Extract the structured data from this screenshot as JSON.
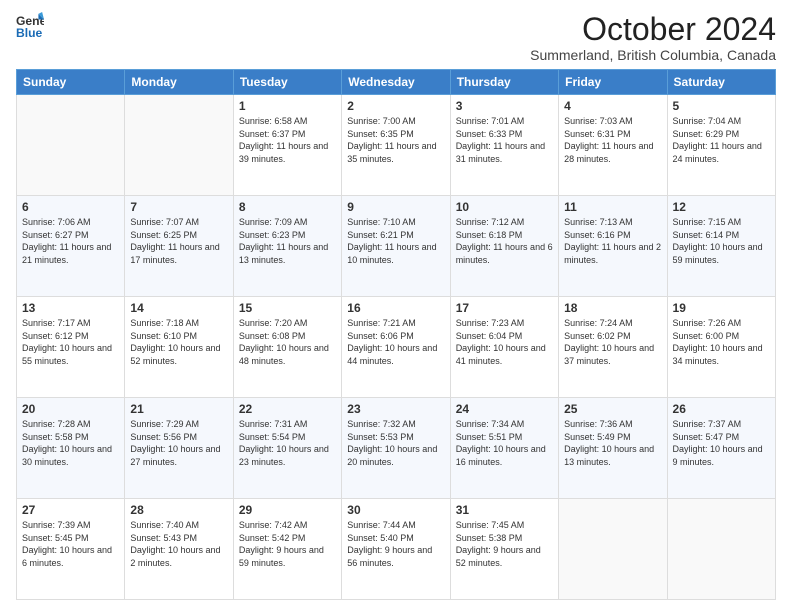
{
  "logo": {
    "line1": "General",
    "line2": "Blue"
  },
  "header": {
    "month": "October 2024",
    "location": "Summerland, British Columbia, Canada"
  },
  "weekdays": [
    "Sunday",
    "Monday",
    "Tuesday",
    "Wednesday",
    "Thursday",
    "Friday",
    "Saturday"
  ],
  "weeks": [
    [
      {
        "day": "",
        "sunrise": "",
        "sunset": "",
        "daylight": ""
      },
      {
        "day": "",
        "sunrise": "",
        "sunset": "",
        "daylight": ""
      },
      {
        "day": "1",
        "sunrise": "Sunrise: 6:58 AM",
        "sunset": "Sunset: 6:37 PM",
        "daylight": "Daylight: 11 hours and 39 minutes."
      },
      {
        "day": "2",
        "sunrise": "Sunrise: 7:00 AM",
        "sunset": "Sunset: 6:35 PM",
        "daylight": "Daylight: 11 hours and 35 minutes."
      },
      {
        "day": "3",
        "sunrise": "Sunrise: 7:01 AM",
        "sunset": "Sunset: 6:33 PM",
        "daylight": "Daylight: 11 hours and 31 minutes."
      },
      {
        "day": "4",
        "sunrise": "Sunrise: 7:03 AM",
        "sunset": "Sunset: 6:31 PM",
        "daylight": "Daylight: 11 hours and 28 minutes."
      },
      {
        "day": "5",
        "sunrise": "Sunrise: 7:04 AM",
        "sunset": "Sunset: 6:29 PM",
        "daylight": "Daylight: 11 hours and 24 minutes."
      }
    ],
    [
      {
        "day": "6",
        "sunrise": "Sunrise: 7:06 AM",
        "sunset": "Sunset: 6:27 PM",
        "daylight": "Daylight: 11 hours and 21 minutes."
      },
      {
        "day": "7",
        "sunrise": "Sunrise: 7:07 AM",
        "sunset": "Sunset: 6:25 PM",
        "daylight": "Daylight: 11 hours and 17 minutes."
      },
      {
        "day": "8",
        "sunrise": "Sunrise: 7:09 AM",
        "sunset": "Sunset: 6:23 PM",
        "daylight": "Daylight: 11 hours and 13 minutes."
      },
      {
        "day": "9",
        "sunrise": "Sunrise: 7:10 AM",
        "sunset": "Sunset: 6:21 PM",
        "daylight": "Daylight: 11 hours and 10 minutes."
      },
      {
        "day": "10",
        "sunrise": "Sunrise: 7:12 AM",
        "sunset": "Sunset: 6:18 PM",
        "daylight": "Daylight: 11 hours and 6 minutes."
      },
      {
        "day": "11",
        "sunrise": "Sunrise: 7:13 AM",
        "sunset": "Sunset: 6:16 PM",
        "daylight": "Daylight: 11 hours and 2 minutes."
      },
      {
        "day": "12",
        "sunrise": "Sunrise: 7:15 AM",
        "sunset": "Sunset: 6:14 PM",
        "daylight": "Daylight: 10 hours and 59 minutes."
      }
    ],
    [
      {
        "day": "13",
        "sunrise": "Sunrise: 7:17 AM",
        "sunset": "Sunset: 6:12 PM",
        "daylight": "Daylight: 10 hours and 55 minutes."
      },
      {
        "day": "14",
        "sunrise": "Sunrise: 7:18 AM",
        "sunset": "Sunset: 6:10 PM",
        "daylight": "Daylight: 10 hours and 52 minutes."
      },
      {
        "day": "15",
        "sunrise": "Sunrise: 7:20 AM",
        "sunset": "Sunset: 6:08 PM",
        "daylight": "Daylight: 10 hours and 48 minutes."
      },
      {
        "day": "16",
        "sunrise": "Sunrise: 7:21 AM",
        "sunset": "Sunset: 6:06 PM",
        "daylight": "Daylight: 10 hours and 44 minutes."
      },
      {
        "day": "17",
        "sunrise": "Sunrise: 7:23 AM",
        "sunset": "Sunset: 6:04 PM",
        "daylight": "Daylight: 10 hours and 41 minutes."
      },
      {
        "day": "18",
        "sunrise": "Sunrise: 7:24 AM",
        "sunset": "Sunset: 6:02 PM",
        "daylight": "Daylight: 10 hours and 37 minutes."
      },
      {
        "day": "19",
        "sunrise": "Sunrise: 7:26 AM",
        "sunset": "Sunset: 6:00 PM",
        "daylight": "Daylight: 10 hours and 34 minutes."
      }
    ],
    [
      {
        "day": "20",
        "sunrise": "Sunrise: 7:28 AM",
        "sunset": "Sunset: 5:58 PM",
        "daylight": "Daylight: 10 hours and 30 minutes."
      },
      {
        "day": "21",
        "sunrise": "Sunrise: 7:29 AM",
        "sunset": "Sunset: 5:56 PM",
        "daylight": "Daylight: 10 hours and 27 minutes."
      },
      {
        "day": "22",
        "sunrise": "Sunrise: 7:31 AM",
        "sunset": "Sunset: 5:54 PM",
        "daylight": "Daylight: 10 hours and 23 minutes."
      },
      {
        "day": "23",
        "sunrise": "Sunrise: 7:32 AM",
        "sunset": "Sunset: 5:53 PM",
        "daylight": "Daylight: 10 hours and 20 minutes."
      },
      {
        "day": "24",
        "sunrise": "Sunrise: 7:34 AM",
        "sunset": "Sunset: 5:51 PM",
        "daylight": "Daylight: 10 hours and 16 minutes."
      },
      {
        "day": "25",
        "sunrise": "Sunrise: 7:36 AM",
        "sunset": "Sunset: 5:49 PM",
        "daylight": "Daylight: 10 hours and 13 minutes."
      },
      {
        "day": "26",
        "sunrise": "Sunrise: 7:37 AM",
        "sunset": "Sunset: 5:47 PM",
        "daylight": "Daylight: 10 hours and 9 minutes."
      }
    ],
    [
      {
        "day": "27",
        "sunrise": "Sunrise: 7:39 AM",
        "sunset": "Sunset: 5:45 PM",
        "daylight": "Daylight: 10 hours and 6 minutes."
      },
      {
        "day": "28",
        "sunrise": "Sunrise: 7:40 AM",
        "sunset": "Sunset: 5:43 PM",
        "daylight": "Daylight: 10 hours and 2 minutes."
      },
      {
        "day": "29",
        "sunrise": "Sunrise: 7:42 AM",
        "sunset": "Sunset: 5:42 PM",
        "daylight": "Daylight: 9 hours and 59 minutes."
      },
      {
        "day": "30",
        "sunrise": "Sunrise: 7:44 AM",
        "sunset": "Sunset: 5:40 PM",
        "daylight": "Daylight: 9 hours and 56 minutes."
      },
      {
        "day": "31",
        "sunrise": "Sunrise: 7:45 AM",
        "sunset": "Sunset: 5:38 PM",
        "daylight": "Daylight: 9 hours and 52 minutes."
      },
      {
        "day": "",
        "sunrise": "",
        "sunset": "",
        "daylight": ""
      },
      {
        "day": "",
        "sunrise": "",
        "sunset": "",
        "daylight": ""
      }
    ]
  ]
}
